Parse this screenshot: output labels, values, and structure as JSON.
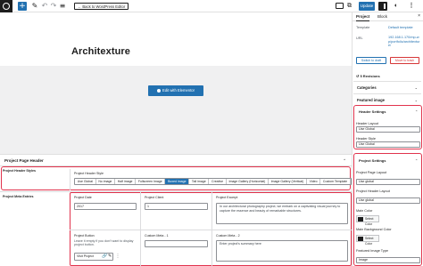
{
  "toolbar": {
    "back_label": "← Back to WordPress Editor",
    "update_label": "Update",
    "add_symbol": "+",
    "edit_symbol": "✎",
    "undo_symbol": "↶",
    "redo_symbol": "↷",
    "list_symbol": "≡"
  },
  "editor": {
    "title": "Architexture",
    "elementor_button": "Edit with Elementor"
  },
  "sidebar": {
    "tabs": [
      "Project",
      "Block"
    ],
    "close_symbol": "×",
    "template_label": "Template",
    "template_value": "Default template",
    "url_label": "URL",
    "url_value": "192.168.1.170/mp-wp/portfolio/architexture/",
    "switch_draft": "Switch to draft",
    "move_trash": "Move to trash",
    "revisions": "5 Revisions",
    "categories": "Categories",
    "featured_image": "Featured image",
    "header_settings": {
      "title": "Header Settings",
      "layout_label": "Header Layout",
      "layout_value": "Use Global",
      "style_label": "Header Style",
      "style_value": "Use Global"
    },
    "project_settings": {
      "title": "Project Settings",
      "page_layout_label": "Project Page Layout",
      "page_layout_value": "Use global",
      "header_layout_label": "Project Header Layout",
      "header_layout_value": "Use global",
      "main_color_label": "Main Color",
      "main_color_btn": "Select Color",
      "main_bg_label": "Main Background Color",
      "main_bg_btn": "Select Color",
      "featured_type_label": "Featured Image Type",
      "featured_type_value": "Image"
    }
  },
  "meta": {
    "header_title": "Project Page Header",
    "header_styles_label": "Project Header Styles",
    "header_style_label": "Project Header Style",
    "header_style_options": [
      "Use Global",
      "No image",
      "Half image",
      "Fullscreen Image",
      "Boxed image",
      "Tall image",
      "Creative",
      "Image Gallery (Horizontal)",
      "Image Gallery (Vertical)",
      "Video",
      "Custom Template"
    ],
    "header_style_selected": "Boxed image",
    "entries_label": "Project Meta Entries",
    "date_label": "Project Date",
    "date_value": "2017",
    "client_label": "Project Client",
    "client_value": "1",
    "excerpt_label": "Project Excerpt",
    "excerpt_value": "In our architectural photography project, we embark on a captivating visual journey to capture the essence and beauty of remarkable structures.",
    "button_label": "Project Button",
    "button_help": "Leave it empty if you don't want to display project button.",
    "button_value": "Visit Project",
    "custom_meta_1_label": "Custom Meta - 1",
    "custom_meta_2_label": "Custom Meta - 2",
    "custom_meta_2_placeholder": "Enter project's summary here"
  },
  "colors": {
    "accent": "#2271b1",
    "highlight": "#e1334d"
  }
}
